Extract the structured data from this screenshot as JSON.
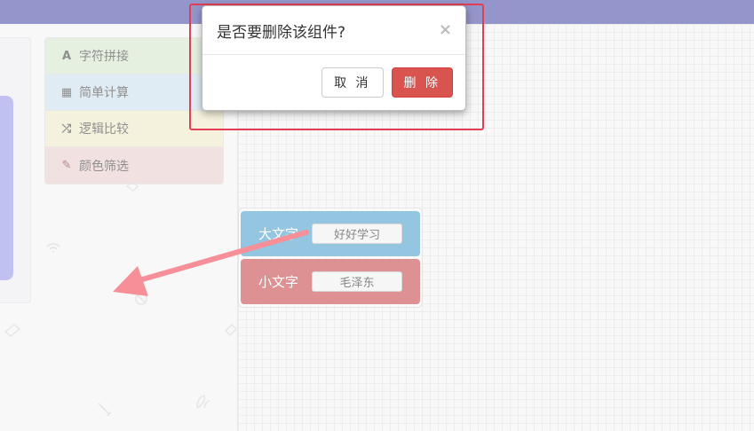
{
  "palette": {
    "items": [
      {
        "icon": "A",
        "label": "字符拼接"
      },
      {
        "icon": "▦",
        "label": "简单计算"
      },
      {
        "icon": "⤮",
        "label": "逻辑比较"
      },
      {
        "icon": "✎",
        "label": "颜色筛选"
      }
    ]
  },
  "components": [
    {
      "label": "大文字",
      "value": "好好学习"
    },
    {
      "label": "小文字",
      "value": "毛泽东"
    }
  ],
  "modal": {
    "title": "是否要删除该组件?",
    "close_symbol": "×",
    "cancel_label": "取 消",
    "delete_label": "删 除"
  },
  "colors": {
    "header": "#3c3f9e",
    "danger": "#d9534f",
    "highlight": "#e43d55",
    "comp_blue": "#3f97c8",
    "comp_red": "#c2373a"
  }
}
